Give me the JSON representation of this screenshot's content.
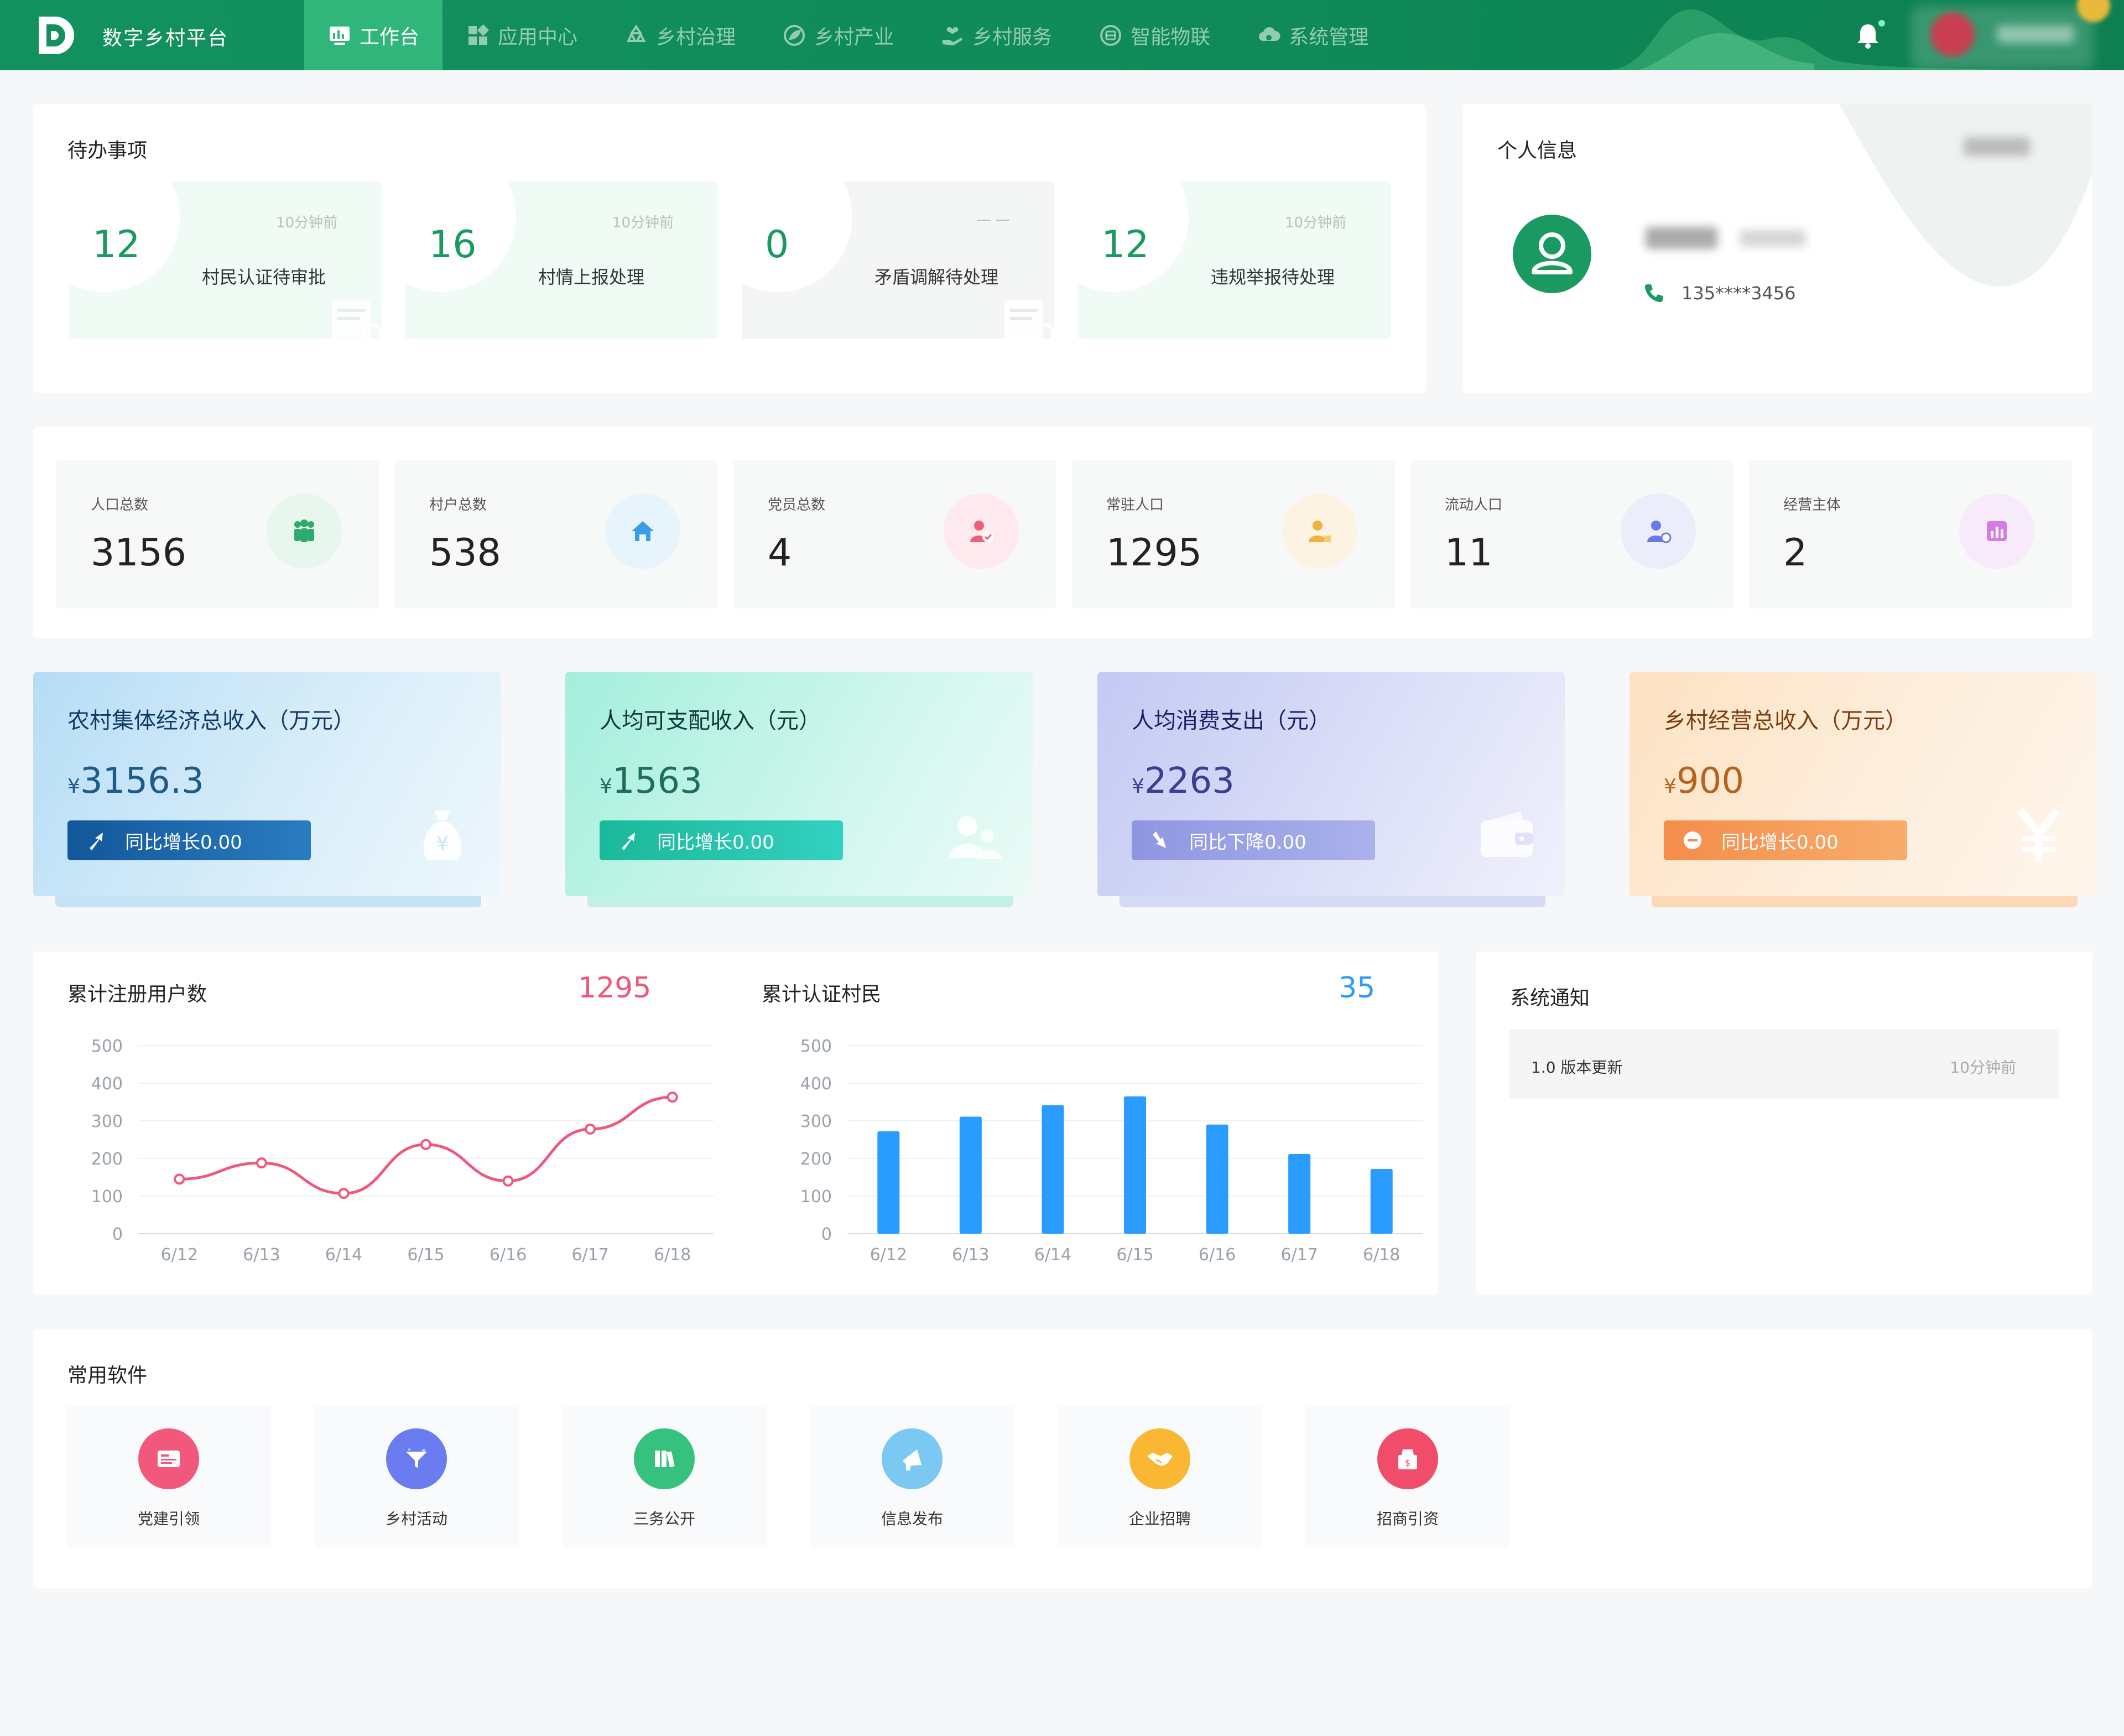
{
  "app": {
    "title": "数字乡村平台"
  },
  "nav": [
    {
      "label": "工作台",
      "icon": "monitor-icon",
      "active": true
    },
    {
      "label": "应用中心",
      "icon": "grid-icon"
    },
    {
      "label": "乡村治理",
      "icon": "recycle-icon"
    },
    {
      "label": "乡村产业",
      "icon": "leaf-icon"
    },
    {
      "label": "乡村服务",
      "icon": "hand-heart-icon"
    },
    {
      "label": "智能物联",
      "icon": "chip-icon"
    },
    {
      "label": "系统管理",
      "icon": "cloud-gear-icon"
    }
  ],
  "todo": {
    "title": "待办事项",
    "items": [
      {
        "count": "12",
        "time": "10分钟前",
        "label": "村民认证待审批"
      },
      {
        "count": "16",
        "time": "10分钟前",
        "label": "村情上报处理"
      },
      {
        "count": "0",
        "time": "— —",
        "label": "矛盾调解待处理"
      },
      {
        "count": "12",
        "time": "10分钟前",
        "label": "违规举报待处理"
      }
    ]
  },
  "profile": {
    "title": "个人信息",
    "phone": "135****3456"
  },
  "stats": [
    {
      "label": "人口总数",
      "value": "3156",
      "icon": "people-group-icon",
      "color": "#2daa6c",
      "bg": "#e8f7ee"
    },
    {
      "label": "村户总数",
      "value": "538",
      "icon": "house-icon",
      "color": "#3a9ee6",
      "bg": "#e8f4fc"
    },
    {
      "label": "党员总数",
      "value": "4",
      "icon": "party-member-icon",
      "color": "#ef5f7c",
      "bg": "#fde9ee"
    },
    {
      "label": "常驻人口",
      "value": "1295",
      "icon": "resident-icon",
      "color": "#f0b23a",
      "bg": "#fdf3e2"
    },
    {
      "label": "流动人口",
      "value": "11",
      "icon": "migrant-icon",
      "color": "#6a79e8",
      "bg": "#ebedfb"
    },
    {
      "label": "经营主体",
      "value": "2",
      "icon": "bar-chart-icon",
      "color": "#d67ae6",
      "bg": "#f7ebfb"
    }
  ],
  "finance": [
    {
      "title": "农村集体经济总收入（万元）",
      "value": "3156.3",
      "currency": "¥",
      "badge": "同比增长0.00",
      "direction": "up",
      "icon": "money-bag-icon"
    },
    {
      "title": "人均可支配收入（元）",
      "value": "1563",
      "currency": "¥",
      "badge": "同比增长0.00",
      "direction": "up",
      "icon": "users-icon"
    },
    {
      "title": "人均消费支出（元）",
      "value": "2263",
      "currency": "¥",
      "badge": "同比下降0.00",
      "direction": "down",
      "icon": "wallet-icon"
    },
    {
      "title": "乡村经营总收入（万元）",
      "value": "900",
      "currency": "¥",
      "badge": "同比增长0.00",
      "direction": "flat",
      "icon": "yen-icon"
    }
  ],
  "charts": {
    "users": {
      "title": "累计注册用户数",
      "total": "1295"
    },
    "certified": {
      "title": "累计认证村民",
      "total": "35"
    }
  },
  "chart_data": [
    {
      "type": "line",
      "title": "累计注册用户数",
      "categories": [
        "6/12",
        "6/13",
        "6/14",
        "6/15",
        "6/16",
        "6/17",
        "6/18"
      ],
      "values": [
        145,
        188,
        107,
        237,
        140,
        278,
        363
      ],
      "ylim": [
        0,
        500
      ],
      "yticks": [
        0,
        100,
        200,
        300,
        400,
        500
      ],
      "color": "#f0577c",
      "grid": true
    },
    {
      "type": "bar",
      "title": "累计认证村民",
      "categories": [
        "6/12",
        "6/13",
        "6/14",
        "6/15",
        "6/16",
        "6/17",
        "6/18"
      ],
      "values": [
        272,
        311,
        342,
        365,
        290,
        212,
        172
      ],
      "ylim": [
        0,
        500
      ],
      "yticks": [
        0,
        100,
        200,
        300,
        400,
        500
      ],
      "color": "#2b9cff",
      "grid": true
    }
  ],
  "notice": {
    "title": "系统通知",
    "items": [
      {
        "title": "1.0 版本更新",
        "time": "10分钟前"
      }
    ]
  },
  "apps": {
    "title": "常用软件",
    "items": [
      {
        "label": "党建引领",
        "icon": "id-card-icon",
        "color": "#f2587c"
      },
      {
        "label": "乡村活动",
        "icon": "party-popper-icon",
        "color": "#6b7bf0"
      },
      {
        "label": "三务公开",
        "icon": "books-icon",
        "color": "#36c17e"
      },
      {
        "label": "信息发布",
        "icon": "megaphone-icon",
        "color": "#7bc9f2"
      },
      {
        "label": "企业招聘",
        "icon": "handshake-icon",
        "color": "#f9b733"
      },
      {
        "label": "招商引资",
        "icon": "money-box-icon",
        "color": "#ef4d6a"
      }
    ]
  }
}
